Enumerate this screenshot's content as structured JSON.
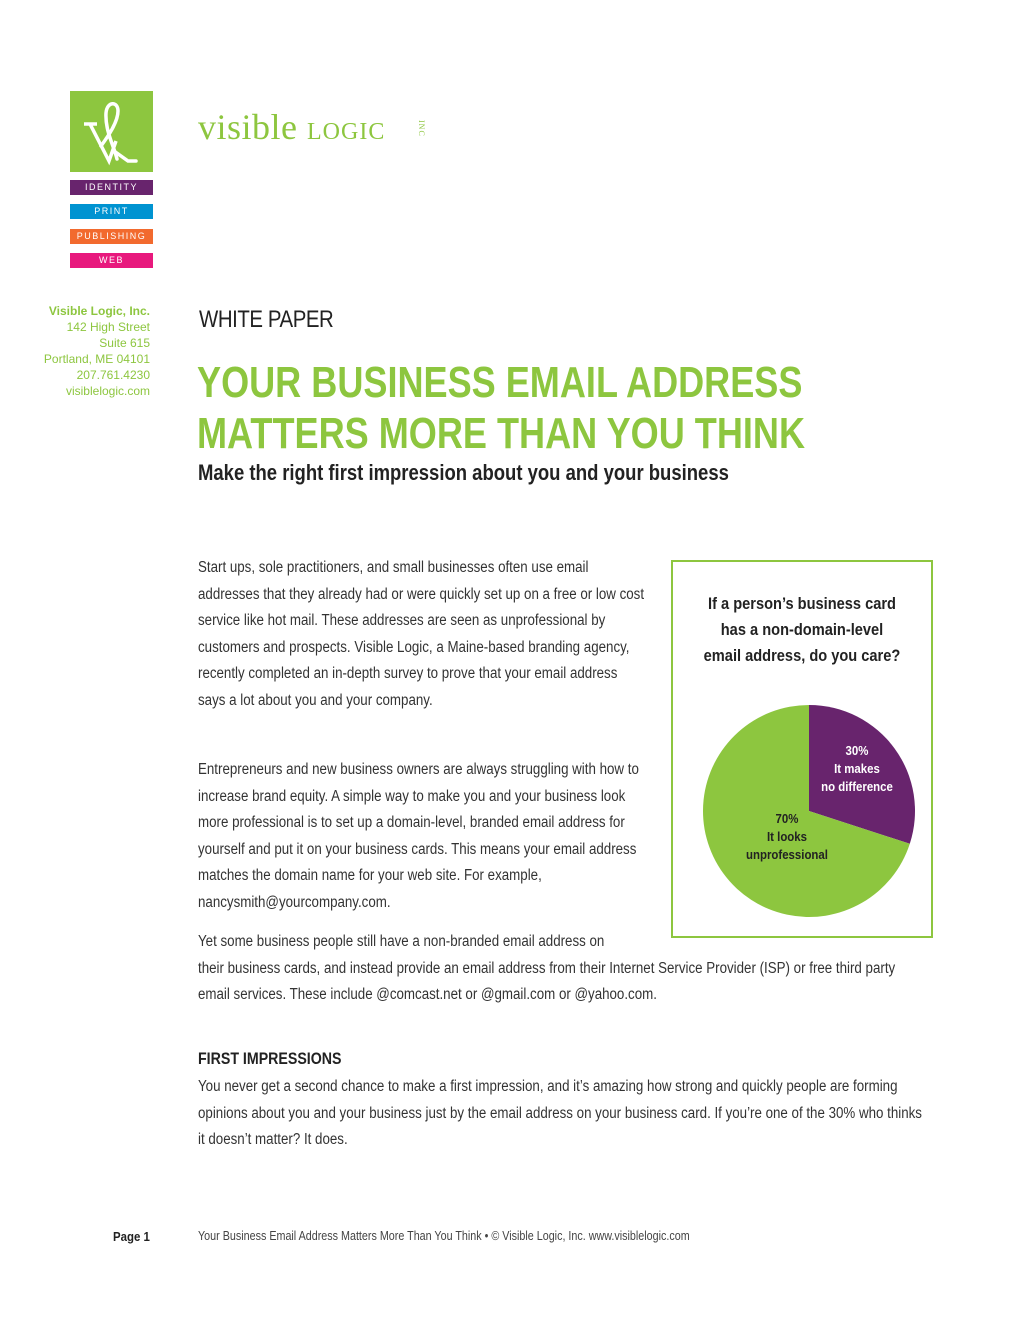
{
  "brand": {
    "name_main": "visible",
    "name_logic": "LOGIC",
    "name_inc": "INC",
    "colors": {
      "green": "#8dc63f",
      "purple": "#68246d",
      "blue": "#0093d1",
      "orange": "#f26a2e",
      "pink": "#e8197d"
    },
    "tags": [
      "IDENTITY",
      "PRINT",
      "PUBLISHING",
      "WEB"
    ]
  },
  "address": {
    "company": "Visible Logic, Inc.",
    "street": "142 High Street",
    "suite": "Suite 615",
    "city": "Portland, ME 04101",
    "phone": "207.761.4230",
    "web": "visiblelogic.com"
  },
  "header": {
    "label": "WHITE PAPER",
    "title_line1": "YOUR BUSINESS EMAIL ADDRESS",
    "title_line2": "MATTERS MORE THAN YOU THINK",
    "subtitle": "Make the right first impression about you and your business"
  },
  "body": {
    "p1": "Start ups, sole practitioners, and small businesses often use email addresses that they already had or were quickly set up on a free or low cost service like hot mail. These addresses are seen as unprofessional by customers and prospects. Visible Logic, a Maine-based branding agency, recently completed an in-depth survey to prove that your email address says a lot about you and your company.",
    "p2": "Entrepreneurs and new business owners are always struggling with how to increase brand equity. A simple way to make you and your business look more professional is to set up a domain-level, branded email address for yourself and put it on your business cards. This means your email address matches the domain name for your web site. For example, nancysmith@yourcompany.com.",
    "p3_line1": "Yet some business people still have a non-branded email address on",
    "p3_rest": "their business cards, and instead provide an email address from their Internet Service Provider (ISP) or free third party email services. These include @comcast.net or @gmail.com or @yahoo.com.",
    "section_heading": "FIRST IMPRESSIONS",
    "p4": "You never get a second chance to make a first impression, and it’s amazing how strong and quickly people are forming opinions about you and your business just by the email address on your business card. If you’re one of the 30% who thinks it doesn’t matter? It does."
  },
  "chart_data": {
    "type": "pie",
    "title": "If a person’s business card has a non-domain-level email address, do you care?",
    "slices": [
      {
        "label": "It makes no difference",
        "value": 30,
        "value_label": "30%",
        "label_lines": [
          "It makes",
          "no difference"
        ],
        "color": "#68246d",
        "text_color": "#ffffff"
      },
      {
        "label": "It looks unprofessional",
        "value": 70,
        "value_label": "70%",
        "label_lines": [
          "It looks",
          "unprofessional"
        ],
        "color": "#8dc63f",
        "text_color": "#222222"
      }
    ],
    "start_angle": "12 o'clock, clockwise"
  },
  "footer": {
    "page": "Page 1",
    "text": "Your Business Email Address Matters More Than You Think  •  © Visible Logic, Inc. www.visiblelogic.com"
  }
}
